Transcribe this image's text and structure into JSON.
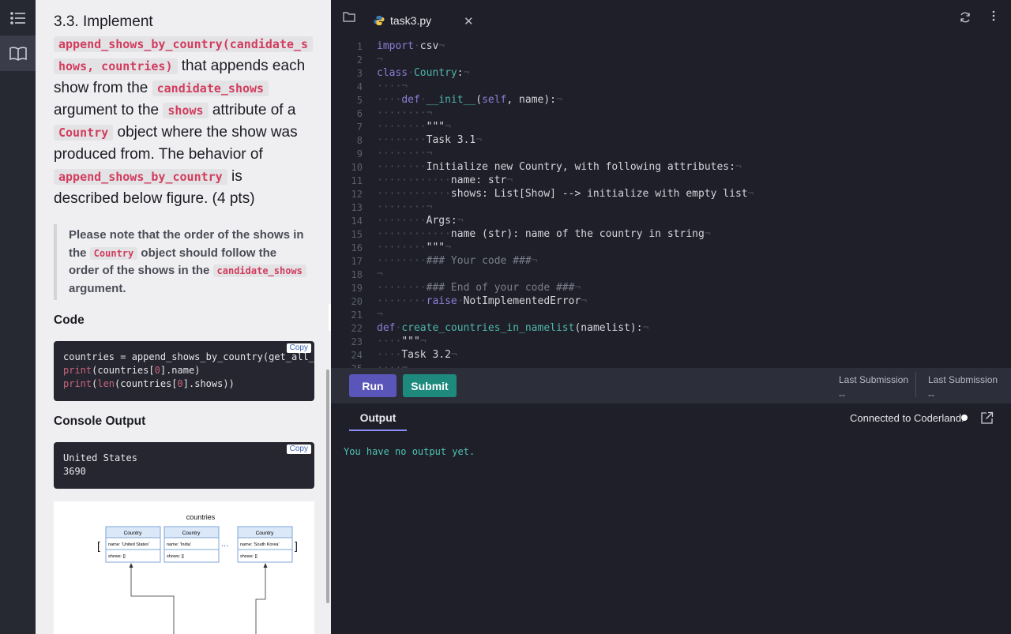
{
  "instructions": {
    "heading_prefix": "3.3. Implement",
    "heading_code": "append_shows_by_country(candidate_shows, countries)",
    "heading_code_l1": "append_shows_by_country(candidate_s",
    "heading_code_l2": "hows, countries)",
    "heading_t1": "that appends each",
    "heading_t2": "show from the",
    "heading_code2": "candidate_shows",
    "heading_t3": "argument to the",
    "heading_code3": "shows",
    "heading_t4": "attribute of a",
    "heading_code4": "Country",
    "heading_t5": "object where the show was",
    "heading_t6": "produced from. The behavior of",
    "heading_code5": "append_shows_by_country",
    "heading_t7": "is",
    "heading_t8": "described below figure. (4 pts)",
    "note_t1": "Please note that the order of the shows in",
    "note_t2": "the",
    "note_code1": "Country",
    "note_t3": "object should follow the",
    "note_t4": "order of the shows in the",
    "note_code2": "candidate_shows",
    "note_t5": "argument.",
    "code_heading": "Code",
    "code_lines": [
      "countries = append_shows_by_country(get_all_sho",
      "print(countries[0].name)",
      "print(len(countries[0].shows))"
    ],
    "copy_label": "Copy",
    "console_heading": "Console Output",
    "console_lines": [
      "United States",
      "3690"
    ],
    "figure": {
      "title": "countries",
      "open_bracket": "[",
      "close_bracket": "]",
      "ellipsis": "...",
      "boxes": [
        {
          "header": "Country",
          "name": "name: 'United States'",
          "shows": "shows: []"
        },
        {
          "header": "Country",
          "name": "name: 'India'",
          "shows": "shows: []"
        },
        {
          "header": "Country",
          "name": "name: 'South Korea'",
          "shows": "shows: []"
        }
      ]
    }
  },
  "editor": {
    "tab_label": "task3.py",
    "lines": [
      {
        "n": "1"
      },
      {
        "n": "2"
      },
      {
        "n": "3"
      },
      {
        "n": "4"
      },
      {
        "n": "5"
      },
      {
        "n": "6"
      },
      {
        "n": "7"
      },
      {
        "n": "8"
      },
      {
        "n": "9"
      },
      {
        "n": "10"
      },
      {
        "n": "11"
      },
      {
        "n": "12"
      },
      {
        "n": "13"
      },
      {
        "n": "14"
      },
      {
        "n": "15"
      },
      {
        "n": "16"
      },
      {
        "n": "17"
      },
      {
        "n": "18"
      },
      {
        "n": "19"
      },
      {
        "n": "20"
      },
      {
        "n": "21"
      },
      {
        "n": "22"
      },
      {
        "n": "23"
      },
      {
        "n": "24"
      },
      {
        "n": "25"
      }
    ],
    "code": {
      "l1_kw": "import",
      "l1_rest": "csv",
      "l3_kw": "class",
      "l3_cls": "Country",
      "l5_kw": "def",
      "l5_fn": "__init__",
      "l5_self": "self",
      "l5_rest": ", name):",
      "l7": "\"\"\"",
      "l8": "Task 3.1",
      "l10": "Initialize new Country, with following attributes:",
      "l11": "name: str",
      "l12": "shows: List[Show] --> initialize with empty list",
      "l14": "Args:",
      "l15": "name (str): name of the country in string",
      "l16": "\"\"\"",
      "l17": "### Your code ###",
      "l19": "### End of your code ###",
      "l20_kw": "raise",
      "l20_rest": "NotImplementedError",
      "l22_kw": "def",
      "l22_fn": "create_countries_in_namelist",
      "l22_rest": "(namelist):",
      "l23": "\"\"\"",
      "l24": "Task 3.2"
    }
  },
  "runbar": {
    "run_label": "Run",
    "submit_label": "Submit",
    "last_submission_label_1": "Last Submission",
    "last_submission_value_1": "--",
    "last_submission_label_2": "Last Submission",
    "last_submission_value_2": "--"
  },
  "output": {
    "tab_label": "Output",
    "connection_status": "Connected to Coderland.",
    "text": "You have no output yet."
  },
  "colors": {
    "run": "#5a55b9",
    "submit": "#1d8a7d",
    "inline_code": "#d23c5d",
    "output_text": "#4fc3b2"
  },
  "icons": [
    "list-icon",
    "book-icon",
    "folder-icon",
    "python-icon",
    "close-icon",
    "refresh-icon",
    "more-vertical-icon",
    "collapse-icon",
    "popout-icon"
  ]
}
